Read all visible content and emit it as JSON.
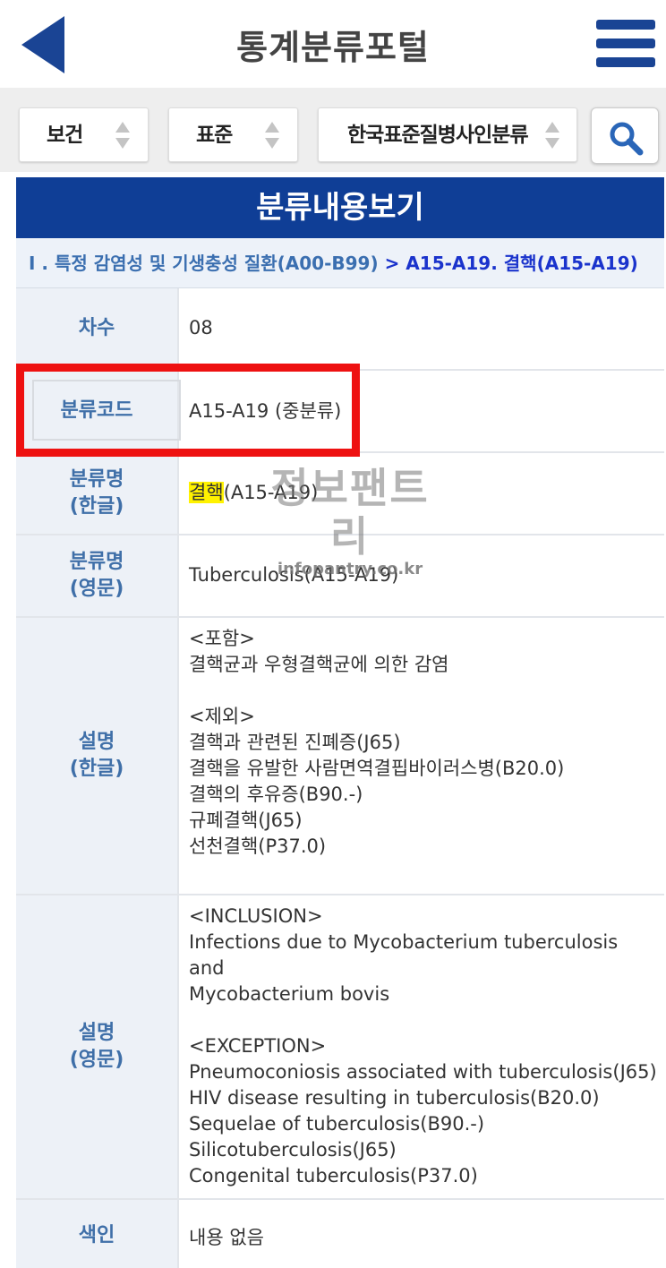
{
  "header": {
    "title": "통계분류포털"
  },
  "filters": {
    "category": "보건",
    "standard": "표준",
    "classification": "한국표준질병사인분류"
  },
  "section": {
    "title": "분류내용보기"
  },
  "breadcrumb": {
    "parent": "I . 특정 감염성 및 기생충성 질환(A00-B99)",
    "separator": ">",
    "current": "A15-A19. 결핵(A15-A19)"
  },
  "rows": {
    "revision": {
      "label": "차수",
      "value": "08"
    },
    "code": {
      "label": "분류코드",
      "value": "A15-A19 (중분류)"
    },
    "name_kr": {
      "label1": "분류명",
      "label2": "(한글)",
      "highlight": "결핵",
      "rest": "(A15-A19)"
    },
    "name_en": {
      "label1": "분류명",
      "label2": "(영문)",
      "value": "Tuberculosis(A15-A19)"
    },
    "desc_kr": {
      "label1": "설명",
      "label2": "(한글)",
      "lines": [
        "<포함>",
        "결핵균과 우형결핵균에 의한 감염",
        "",
        "<제외>",
        "결핵과 관련된 진폐증(J65)",
        "결핵을 유발한 사람면역결핍바이러스병(B20.0)",
        "결핵의 후유증(B90.-)",
        "규폐결핵(J65)",
        "선천결핵(P37.0)"
      ]
    },
    "desc_en": {
      "label1": "설명",
      "label2": "(영문)",
      "lines": [
        "<INCLUSION>",
        "Infections due to Mycobacterium tuberculosis and",
        "Mycobacterium bovis",
        "",
        "<EXCEPTION>",
        "Pneumoconiosis associated with tuberculosis(J65)",
        "HIV disease resulting in tuberculosis(B20.0)",
        "Sequelae of tuberculosis(B90.-)",
        "Silicotuberculosis(J65)",
        "Congenital tuberculosis(P37.0)"
      ]
    },
    "index": {
      "label": "색인",
      "value": "내용 없음"
    }
  },
  "watermark": {
    "brand": "정보팬트리",
    "url": "infopantry.co.kr"
  },
  "colors": {
    "brand_blue": "#0f3e96",
    "label_blue": "#3f6fa8",
    "annotation_red": "#ee1111",
    "highlight_yellow": "#fff200"
  }
}
